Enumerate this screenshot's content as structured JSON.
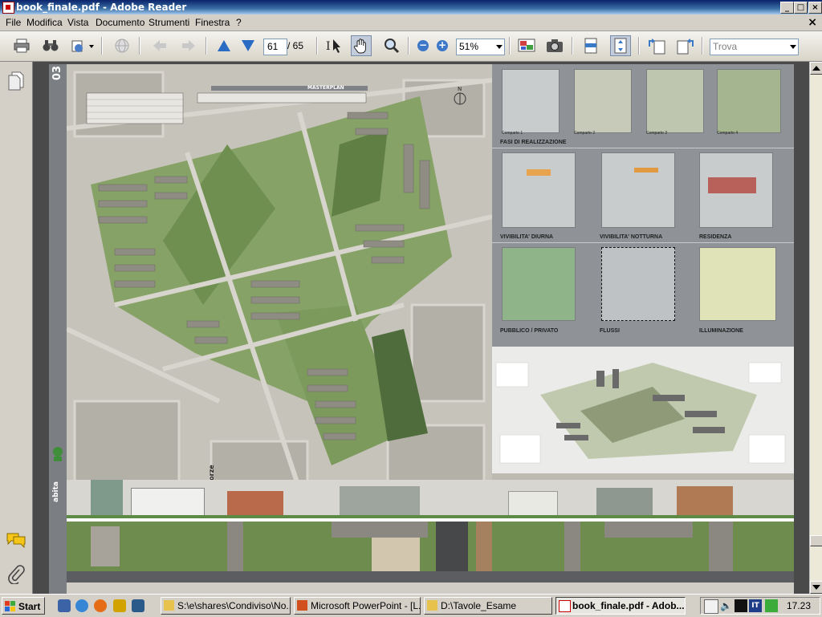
{
  "window": {
    "title": "book_finale.pdf - Adobe Reader",
    "controls": {
      "minimize": "_",
      "maximize": "□",
      "close": "×"
    }
  },
  "menu": {
    "items": [
      "File",
      "Modifica",
      "Vista",
      "Documento",
      "Strumenti",
      "Finestra",
      "?"
    ],
    "close_glyph": "×"
  },
  "toolbar": {
    "page_current": "61",
    "page_total": "/ 65",
    "zoom": "51%",
    "search_placeholder": "Trova"
  },
  "document": {
    "sheet_number": "03",
    "masterplan_label": "MASTERPLAN",
    "north_label": "N",
    "street_label": "via delle Forze Armate",
    "logo_text": "abita",
    "panel_captions": [
      "FASI DI REALIZZAZIONE",
      "VIVIBILITA' DIURNA",
      "VIVIBILITA' NOTTURNA",
      "RESIDENZA",
      "PUBBLICO / PRIVATO",
      "FLUSSI",
      "ILLUMINAZIONE"
    ],
    "phase_labels": [
      "Comparto 1",
      "Comparto 2",
      "Comparto 3",
      "Comparto 4"
    ]
  },
  "taskbar": {
    "start": "Start",
    "tasks": [
      {
        "label": "S:\\e\\shares\\Condiviso\\No...",
        "active": false
      },
      {
        "label": "Microsoft PowerPoint - [L...",
        "active": false
      },
      {
        "label": "D:\\Tavole_Esame",
        "active": false
      },
      {
        "label": "book_finale.pdf - Adob...",
        "active": true
      }
    ],
    "language": "IT",
    "clock": "17.23"
  },
  "colors": {
    "titlebar": "#0a246a",
    "chrome": "#d4d0c8",
    "accent_blue": "#2a6bc4",
    "map_green": "#7d9a5d"
  },
  "icons": {
    "toolbar": [
      "print-icon",
      "binoculars-icon",
      "share-icon",
      "globe-icon",
      "back-icon",
      "forward-icon",
      "prev-page-icon",
      "next-page-icon",
      "select-text-icon",
      "hand-tool-icon",
      "zoom-tool-icon",
      "zoom-out-icon",
      "zoom-in-icon",
      "snapshot-icon",
      "camera-icon",
      "fit-width-icon",
      "fit-page-icon",
      "rotate-left-icon",
      "rotate-right-icon"
    ],
    "navpanel": [
      "pages-icon",
      "comments-icon",
      "attachments-icon"
    ]
  }
}
